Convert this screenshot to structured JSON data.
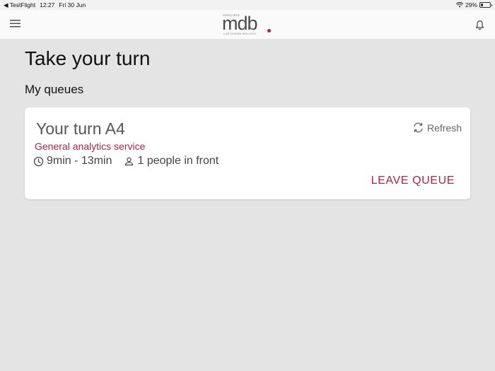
{
  "status_bar": {
    "back_app": "◀ TestFlight",
    "time": "12:27",
    "date": "Fri 30 Jun",
    "battery": "29%",
    "battery_level": 0.29
  },
  "header": {
    "logo": {
      "top_text": "ANALISIS",
      "main_text": "mdb",
      "sub_text": "LAB DURÁN BELLIDO"
    },
    "icons": {
      "menu": "menu-icon",
      "notifications": "bell-icon"
    }
  },
  "main": {
    "page_title": "Take your turn",
    "section_title": "My queues",
    "queue_card": {
      "turn_label": "Your turn A4",
      "service": "General analytics service",
      "wait_time": "9min - 13min",
      "people_in_front": "1 people in front",
      "refresh_label": "Refresh",
      "leave_label": "LEAVE QUEUE"
    }
  },
  "colors": {
    "accent": "#b5213a",
    "background": "#e4e4e4",
    "card": "#ffffff"
  }
}
